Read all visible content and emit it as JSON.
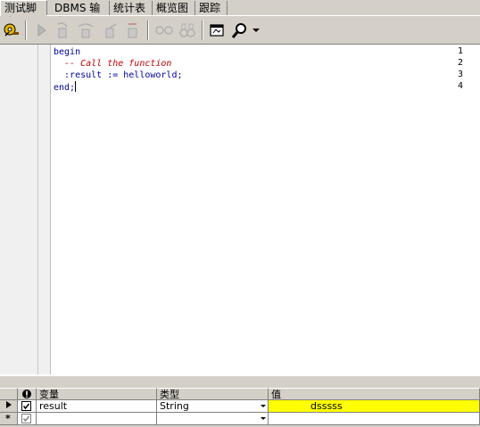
{
  "tabs": [
    "测试脚本",
    "DBMS 输出",
    "统计表",
    "概览图",
    "跟踪"
  ],
  "toolbar": {
    "icons": [
      "debug-key-icon",
      "run-icon",
      "step-into-icon",
      "step-over-icon",
      "step-out-icon",
      "break-icon",
      "glasses-icon",
      "binoculars-icon",
      "window-icon",
      "magnifier-icon",
      "dropdown-arrow-icon"
    ]
  },
  "editor": {
    "line_numbers": [
      "1",
      "2",
      "3",
      "4"
    ],
    "lines": {
      "l1": "begin",
      "l2": "  -- Call the function",
      "l3": "  :result := helloworld;",
      "l4": "end;"
    }
  },
  "grid": {
    "headers": {
      "variable": "变量",
      "type": "类型",
      "value": "值"
    },
    "rows": [
      {
        "variable": "result",
        "type": "String",
        "value": "dsssss",
        "checked": true
      },
      {
        "variable": "",
        "type": "",
        "value": "",
        "checked": true
      }
    ],
    "highlight_color": "#ffff00",
    "new_row_marker": "*"
  }
}
